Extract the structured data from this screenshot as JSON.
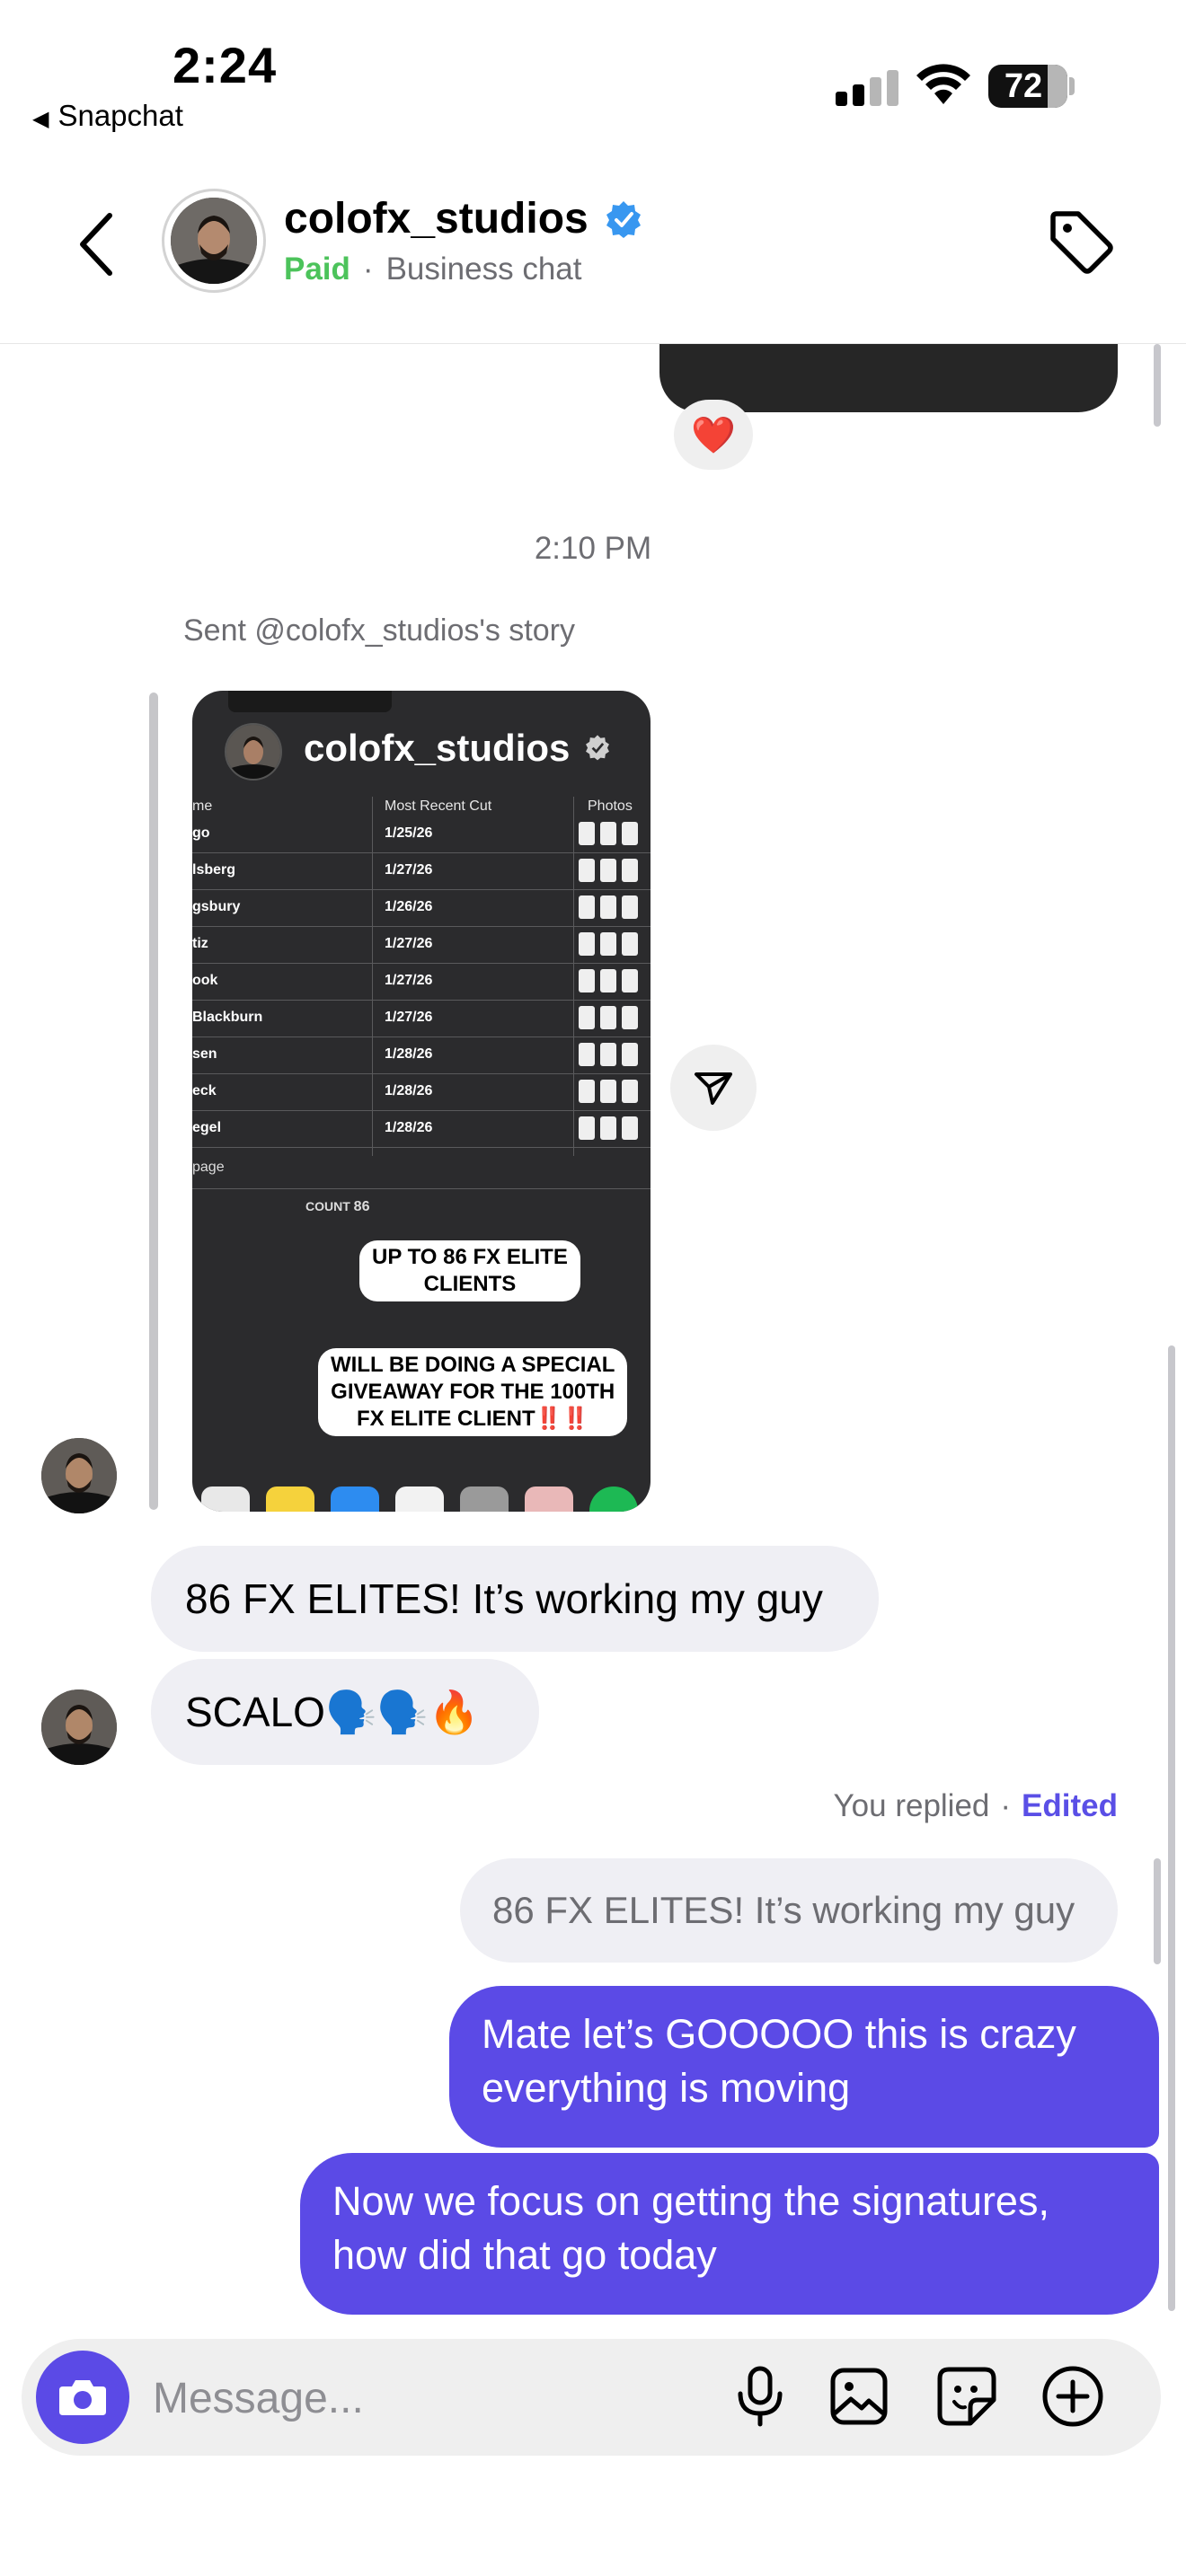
{
  "status_bar": {
    "time": "2:24",
    "back_app": "Snapchat",
    "battery": "72"
  },
  "header": {
    "name": "colofx_studios",
    "paid": "Paid",
    "separator": "·",
    "sub": "Business chat"
  },
  "chat": {
    "reaction": "❤️",
    "timestamp": "2:10 PM",
    "story_caption": "Sent @colofx_studios's story",
    "story": {
      "username": "colofx_studios",
      "col_name": "me",
      "col_cut": "Most Recent Cut",
      "col_photos": "Photos",
      "rows": [
        {
          "name": "go",
          "date": "1/25/26"
        },
        {
          "name": "lsberg",
          "date": "1/27/26"
        },
        {
          "name": "gsbury",
          "date": "1/26/26"
        },
        {
          "name": "tiz",
          "date": "1/27/26"
        },
        {
          "name": "ook",
          "date": "1/27/26"
        },
        {
          "name": "Blackburn",
          "date": "1/27/26"
        },
        {
          "name": "sen",
          "date": "1/28/26"
        },
        {
          "name": "eck",
          "date": "1/28/26"
        },
        {
          "name": "egel",
          "date": "1/28/26"
        }
      ],
      "page_label": "page",
      "count_label": "COUNT",
      "count_value": "86",
      "pill1_line1": "UP TO 86 FX ELITE",
      "pill1_line2": "CLIENTS",
      "pill2_line1": "WILL BE DOING A SPECIAL",
      "pill2_line2": "GIVEAWAY FOR THE 100TH",
      "pill2_line3": "FX ELITE CLIENT‼️‼️"
    },
    "incoming": [
      {
        "text": "86 FX ELITES! It’s working my guy"
      },
      {
        "text": "SCALO🗣️🗣️🔥"
      }
    ],
    "replied_label": "You replied",
    "replied_sep": "·",
    "edited_label": "Edited",
    "quoted": "86 FX ELITES! It’s working my guy",
    "outgoing": [
      {
        "text": "Mate let’s GOOOOO this is crazy everything is moving"
      },
      {
        "text": "Now we focus on getting the signatures, how did that go today"
      }
    ]
  },
  "composer": {
    "placeholder": "Message..."
  },
  "colors": {
    "accent": "#5b4ae6",
    "paid": "#4cc35b",
    "bubble_in": "#efeff4"
  }
}
